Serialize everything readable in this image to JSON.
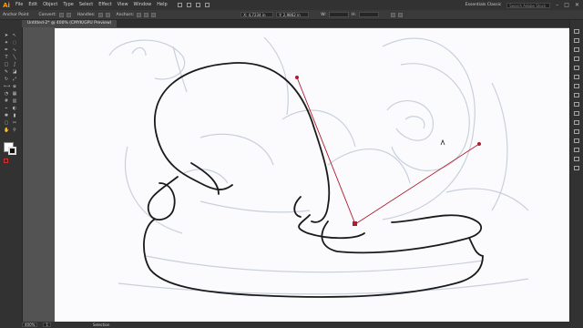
{
  "app": {
    "logo": "Ai"
  },
  "menu": {
    "items": [
      "File",
      "Edit",
      "Object",
      "Type",
      "Select",
      "Effect",
      "View",
      "Window",
      "Help"
    ]
  },
  "header": {
    "workspace": "Essentials Classic",
    "search_placeholder": "Search Adobe Stock"
  },
  "control_bar": {
    "tool_label": "Anchor Point",
    "convert_label": "Convert:",
    "handles_label": "Handles:",
    "anchors_label": "Anchors:",
    "x_value": "X: 4,7234 in",
    "y_value": "Y: 2,9862 in",
    "w_value": "W:",
    "h_value": "H:"
  },
  "document": {
    "tab_title": "Untitled-2* @ 400% (CMYK/GPU Preview)"
  },
  "status": {
    "zoom": "400%",
    "artboard": "1",
    "tool_name": "Selection"
  },
  "colors": {
    "path": "#1a1a1a",
    "handle": "#b01c2e",
    "sketch": "#c9d0dc",
    "accent": "#ff9a00"
  }
}
